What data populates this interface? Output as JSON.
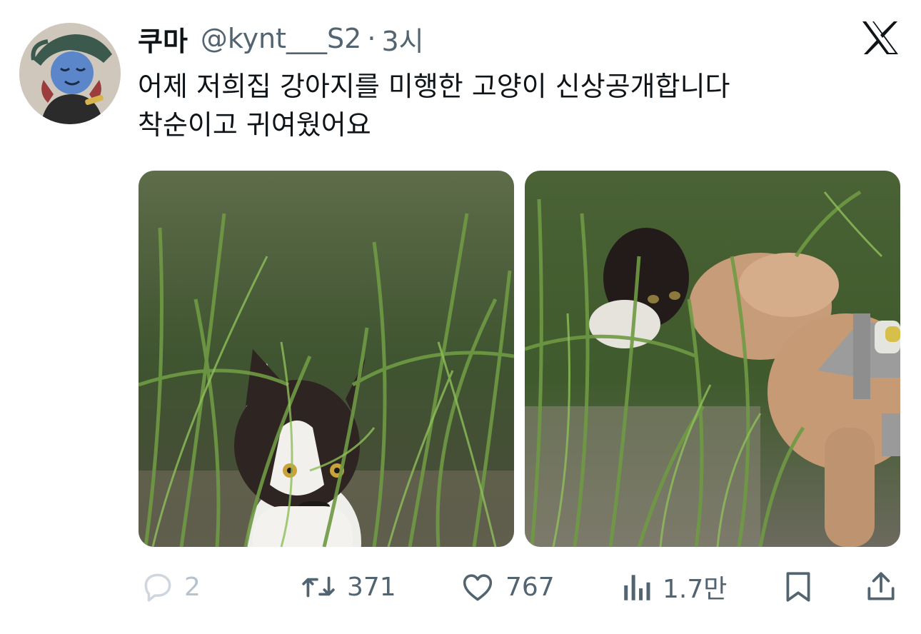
{
  "tweet": {
    "author": {
      "display_name": "쿠마",
      "handle": "@kynt___S2",
      "time": "3시",
      "separator": "·"
    },
    "text_lines": [
      "어제 저희집 강아지를 미행한 고양이 신상공개합니다",
      "착순이고 귀여웠어요"
    ],
    "media": [
      {
        "description_icon": "kitten-in-grass-photo"
      },
      {
        "description_icon": "kitten-and-dog-in-grass-photo"
      }
    ],
    "actions": {
      "replies": "2",
      "retweets": "371",
      "likes": "767",
      "views": "1.7만"
    }
  },
  "colors": {
    "text_primary": "#0f1419",
    "text_secondary": "#536471",
    "reply_faded": "#b8c2cc"
  }
}
